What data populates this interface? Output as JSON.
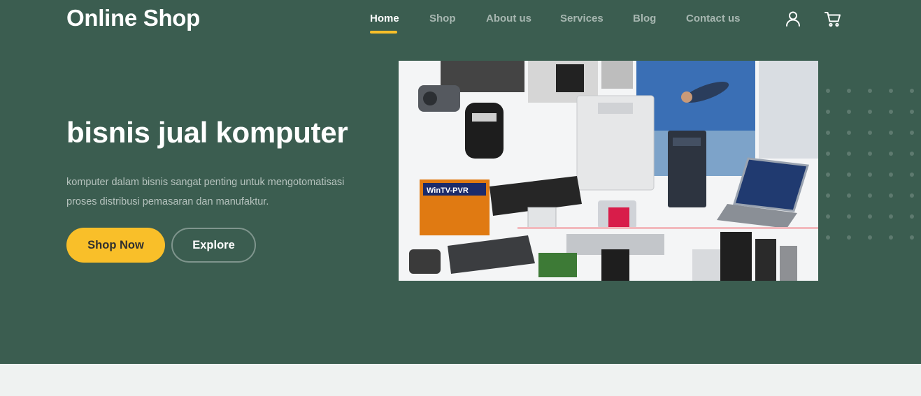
{
  "brand": "Online Shop",
  "nav": {
    "items": [
      {
        "label": "Home",
        "active": true
      },
      {
        "label": "Shop",
        "active": false
      },
      {
        "label": "About us",
        "active": false
      },
      {
        "label": "Services",
        "active": false
      },
      {
        "label": "Blog",
        "active": false
      },
      {
        "label": "Contact us",
        "active": false
      }
    ]
  },
  "header_icons": [
    "user-icon",
    "cart-icon"
  ],
  "hero": {
    "title": "bisnis jual komputer",
    "description": "komputer dalam bisnis sangat penting untuk mengotomatisasi proses distribusi pemasaran dan manufaktur.",
    "primary_button": "Shop Now",
    "secondary_button": "Explore",
    "image_subject": "collage of computer hardware and electronics",
    "image_text": "WinTV-PVR"
  },
  "colors": {
    "hero_background": "#3b5d50",
    "accent": "#f9bf29",
    "page_background": "#eff2f1",
    "text_light": "#ffffff"
  }
}
